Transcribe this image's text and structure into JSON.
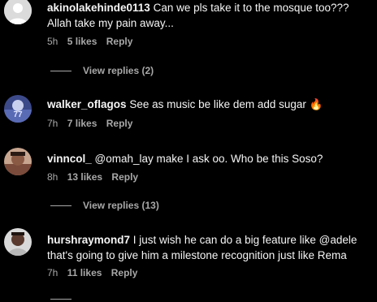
{
  "comments": [
    {
      "username": "akinolakehinde0113",
      "lines": [
        "Can we pls take it to the mosque too???",
        "Allah take my pain away..."
      ],
      "time": "5h",
      "likes": "5 likes",
      "reply": "Reply",
      "view_replies": "View replies (2)"
    },
    {
      "username": "walker_oflagos",
      "lines": [
        "See as music be like dem add sugar"
      ],
      "emoji": "🔥",
      "time": "7h",
      "likes": "7 likes",
      "reply": "Reply"
    },
    {
      "username": "vinncol_",
      "lines": [
        "@omah_lay make I ask oo. Who be this Soso?"
      ],
      "time": "8h",
      "likes": "13 likes",
      "reply": "Reply",
      "view_replies": "View replies (13)"
    },
    {
      "username": "hurshraymond7",
      "lines": [
        "I just wish he can do a big feature like @adele",
        "that's going to give him a milestone recognition just like Rema"
      ],
      "time": "7h",
      "likes": "11 likes",
      "reply": "Reply"
    }
  ],
  "colors": {
    "background": "#000000",
    "text": "#f5f5f5",
    "secondary": "#a8a8a8"
  }
}
